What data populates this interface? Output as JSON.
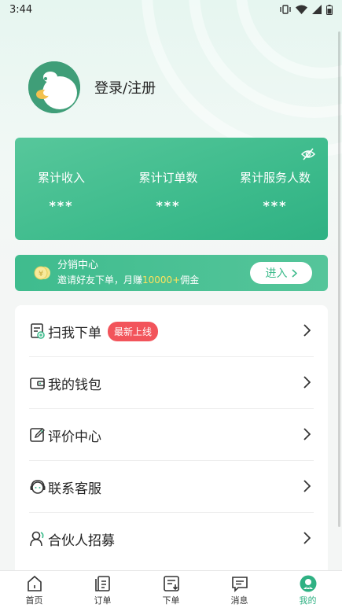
{
  "status_bar": {
    "time": "3:44"
  },
  "profile": {
    "login_text": "登录/注册"
  },
  "stats": [
    {
      "label": "累计收入",
      "value": "***"
    },
    {
      "label": "累计订单数",
      "value": "***"
    },
    {
      "label": "累计服务人数",
      "value": "***"
    }
  ],
  "distribution": {
    "title": "分销中心",
    "subtitle_prefix": "邀请好友下单，月赚",
    "subtitle_highlight": "10000+",
    "subtitle_suffix": "佣金",
    "button_label": "进入"
  },
  "menu": {
    "items": [
      {
        "label": "扫我下单",
        "badge": "最新上线",
        "icon": "scan-order-icon"
      },
      {
        "label": "我的钱包",
        "icon": "wallet-icon"
      },
      {
        "label": "评价中心",
        "icon": "edit-review-icon"
      },
      {
        "label": "联系客服",
        "icon": "customer-service-icon"
      },
      {
        "label": "合伙人招募",
        "icon": "partner-icon"
      }
    ]
  },
  "tabbar": {
    "tabs": [
      {
        "label": "首页",
        "icon": "home-icon"
      },
      {
        "label": "订单",
        "icon": "orders-icon"
      },
      {
        "label": "下单",
        "icon": "place-order-icon"
      },
      {
        "label": "消息",
        "icon": "message-icon"
      },
      {
        "label": "我的",
        "icon": "profile-icon",
        "active": true
      }
    ]
  },
  "colors": {
    "accent": "#3dbb8c",
    "badge": "#f2545b",
    "highlight": "#ffe25c"
  }
}
